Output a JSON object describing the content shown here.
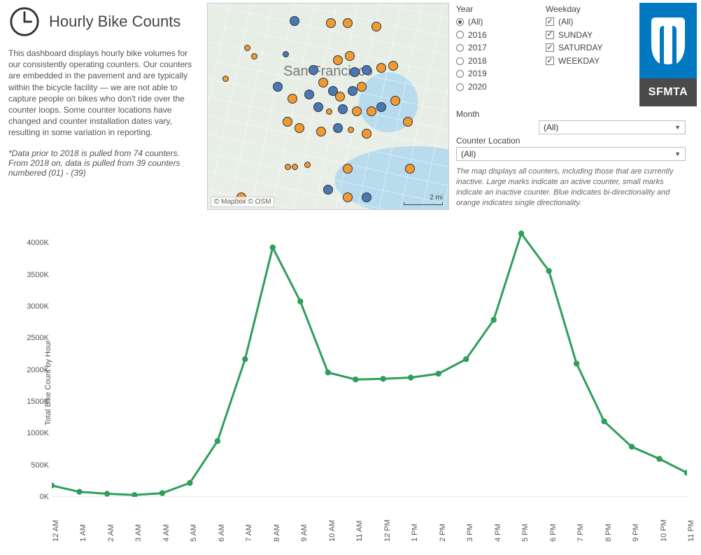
{
  "intro": {
    "title": "Hourly Bike Counts",
    "description": "This dashboard displays hourly bike volumes for our consistently operating counters. Our counters are embedded in the pavement and are typically within the bicycle facility — we are not able to capture people on bikes who don't ride over the counter loops. Some counter locations have changed and counter installation dates vary, resulting in some variation in reporting.",
    "footnote": "*Data prior to 2018 is pulled from 74 counters. From 2018 on, data is pulled from 39 counters numbered (01) - (39)"
  },
  "map": {
    "city_label": "San Francisco",
    "attribution": "© Mapbox © OSM",
    "scale_label": "2 mi"
  },
  "filters": {
    "year": {
      "heading": "Year",
      "options": [
        "(All)",
        "2016",
        "2017",
        "2018",
        "2019",
        "2020"
      ],
      "selected": "(All)"
    },
    "weekday": {
      "heading": "Weekday",
      "options": [
        "(All)",
        "SUNDAY",
        "SATURDAY",
        "WEEKDAY"
      ],
      "checked": [
        "(All)",
        "SUNDAY",
        "SATURDAY",
        "WEEKDAY"
      ]
    },
    "month": {
      "heading": "Month",
      "value": "(All)"
    },
    "counter_location": {
      "heading": "Counter Location",
      "value": "(All)"
    },
    "note": "The map displays all counters, including those that are currently inactive. Large marks indicate an active counter, small marks indicate an inactive counter. Blue indicates bi-directionality and orange indicates single directionality."
  },
  "logo": {
    "text": "SFMTA"
  },
  "chart_data": {
    "type": "line",
    "title": "",
    "xlabel": "",
    "ylabel": "Total Bike Count by Hour",
    "categories": [
      "12 AM",
      "1 AM",
      "2 AM",
      "3 AM",
      "4 AM",
      "5 AM",
      "6 AM",
      "7 AM",
      "8 AM",
      "9 AM",
      "10 AM",
      "11 AM",
      "12 PM",
      "1 PM",
      "2 PM",
      "3 PM",
      "4 PM",
      "5 PM",
      "6 PM",
      "7 PM",
      "8 PM",
      "9 PM",
      "10 PM",
      "11 PM"
    ],
    "values": [
      180,
      80,
      50,
      30,
      60,
      220,
      880,
      2170,
      3930,
      3080,
      1960,
      1850,
      1860,
      1880,
      1940,
      2170,
      2790,
      4150,
      3560,
      2100,
      1190,
      790,
      600,
      380
    ],
    "y_ticks": [
      0,
      500,
      1000,
      1500,
      2000,
      2500,
      3000,
      3500,
      4000
    ],
    "y_tick_labels": [
      "0K",
      "500K",
      "1000K",
      "1500K",
      "2000K",
      "2500K",
      "3000K",
      "3500K",
      "4000K"
    ],
    "ylim": [
      0,
      4300
    ],
    "line_color": "#2e9e5b"
  }
}
